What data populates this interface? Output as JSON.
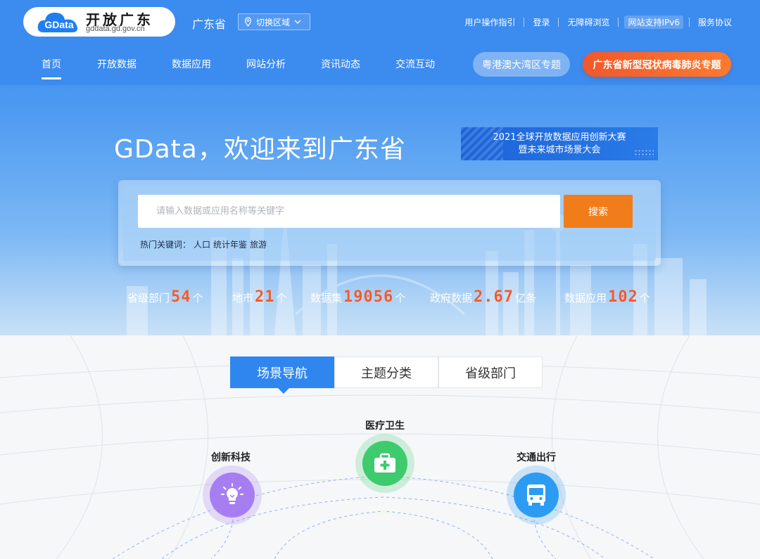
{
  "header": {
    "logo_badge": "GData",
    "logo_title": "开放广东",
    "logo_domain": "gddata.gd.gov.cn",
    "province": "广东省",
    "region_switch": "切换区域",
    "top_links": {
      "guide": "用户操作指引",
      "login": "登录",
      "accessibility": "无障碍浏览",
      "ipv6": "网站支持IPv6",
      "agreement": "服务协议"
    }
  },
  "nav": {
    "items": [
      "首页",
      "开放数据",
      "数据应用",
      "网站分析",
      "资讯动态",
      "交流互动"
    ],
    "active": "首页",
    "special_gba": "粤港澳大湾区专题",
    "special_covid": "广东省新型冠状病毒肺炎专题"
  },
  "hero": {
    "welcome": "GData，欢迎来到广东省",
    "banner_line1": "2021全球开放数据应用创新大赛",
    "banner_line2": "暨未来城市场景大会"
  },
  "search": {
    "placeholder": "请输入数据或应用名称等关键字",
    "button": "搜索",
    "hot_label": "热门关键词：",
    "hot_keywords": [
      "人口",
      "统计年鉴",
      "旅游"
    ]
  },
  "stats": [
    {
      "label": "省级部门",
      "value": "54",
      "unit": "个"
    },
    {
      "label": "地市",
      "value": "21",
      "unit": "个"
    },
    {
      "label": "数据集",
      "value": "19056",
      "unit": "个"
    },
    {
      "label": "政府数据",
      "value": "2.67",
      "unit": "亿条"
    },
    {
      "label": "数据应用",
      "value": "102",
      "unit": "个"
    }
  ],
  "tabs": {
    "items": [
      "场景导航",
      "主题分类",
      "省级部门"
    ],
    "active": "场景导航"
  },
  "scenes": [
    {
      "label": "医疗卫生",
      "icon": "medical-kit-icon",
      "color": "#3dcb6e"
    },
    {
      "label": "创新科技",
      "icon": "lightbulb-icon",
      "color": "#a77ef2"
    },
    {
      "label": "交通出行",
      "icon": "bus-icon",
      "color": "#2c9cf2"
    }
  ],
  "colors": {
    "primary": "#2f86ef",
    "accent_orange": "#f07d1a",
    "stat_number": "#f45a2b"
  }
}
